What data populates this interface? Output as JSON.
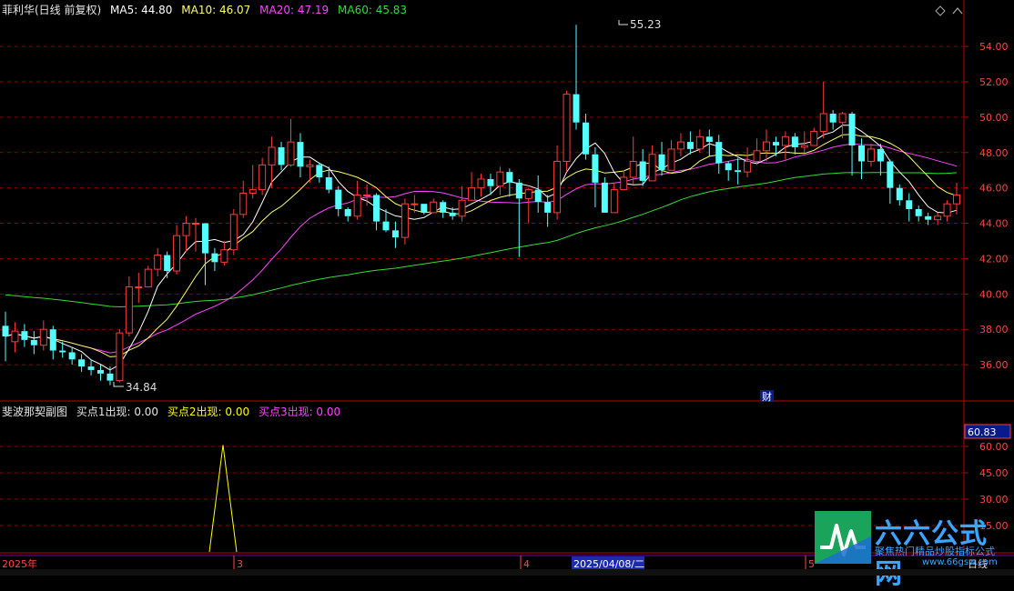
{
  "header": {
    "stock_title": "菲利华(日线 前复权)",
    "ma5": "MA5: 44.80",
    "ma10": "MA10: 46.07",
    "ma20": "MA20: 47.19",
    "ma60": "MA60: 45.83"
  },
  "sub_header": {
    "indicator_name": "斐波那契副图",
    "buy1": "买点1出现: 0.00",
    "buy2": "买点2出现: 0.00",
    "buy3": "买点3出现: 0.00"
  },
  "colors": {
    "up": "#ff3b3b",
    "down": "#54ffff",
    "ma5": "#ffffff",
    "ma10": "#ffff66",
    "ma20": "#ff44ff",
    "ma60": "#33dd33",
    "grid": "#8b0000",
    "axis": "#c00000",
    "label": "#ff4444",
    "indicator": "#ffff00"
  },
  "price_axis": {
    "min": 34,
    "max": 55.6,
    "ticks": [
      "54.00",
      "52.00",
      "50.00",
      "48.00",
      "46.00",
      "44.00",
      "42.00",
      "40.00",
      "38.00",
      "36.00"
    ]
  },
  "indicator_axis": {
    "min": 0,
    "max": 75,
    "ticks": [
      "60.00",
      "45.00",
      "30.00",
      "15.00"
    ],
    "current": "60.83"
  },
  "annotations": {
    "high": "55.23",
    "low": "34.84",
    "finance_marker": "财"
  },
  "bottom_axis": {
    "year": "2025年",
    "month3": "3",
    "month4": "4",
    "month5": "5",
    "date_cursor": "2025/04/08/二",
    "period": "日线"
  },
  "logo": {
    "name": "六六公式网",
    "slogan": "聚焦热门精品炒股指标公式",
    "url": "www.66gsw.com"
  },
  "chart_data": {
    "type": "candlestick",
    "series": [
      {
        "name": "MA5"
      },
      {
        "name": "MA10"
      },
      {
        "name": "MA20"
      },
      {
        "name": "MA60"
      }
    ],
    "candles": [
      [
        38.2,
        37.6,
        39.0,
        36.2
      ],
      [
        37.3,
        37.9,
        38.4,
        36.7
      ],
      [
        37.9,
        37.4,
        38.3,
        37.0
      ],
      [
        37.4,
        37.1,
        37.9,
        36.6
      ],
      [
        37.1,
        38.0,
        38.5,
        36.8
      ],
      [
        38.0,
        36.8,
        38.2,
        36.3
      ],
      [
        36.8,
        36.7,
        37.3,
        36.4
      ],
      [
        36.7,
        36.3,
        37.0,
        36.0
      ],
      [
        36.3,
        35.9,
        36.6,
        35.6
      ],
      [
        35.9,
        35.7,
        36.3,
        35.4
      ],
      [
        35.7,
        35.5,
        36.0,
        35.1
      ],
      [
        35.5,
        35.1,
        35.9,
        34.84
      ],
      [
        35.1,
        37.8,
        38.0,
        35.0
      ],
      [
        37.8,
        40.4,
        41.0,
        37.6
      ],
      [
        40.4,
        40.4,
        41.2,
        39.5
      ],
      [
        40.4,
        41.4,
        41.6,
        40.4
      ],
      [
        41.4,
        42.2,
        42.6,
        41.0
      ],
      [
        42.2,
        41.3,
        42.4,
        40.9
      ],
      [
        41.3,
        43.3,
        43.9,
        41.1
      ],
      [
        43.3,
        44.0,
        44.4,
        42.4
      ],
      [
        44.0,
        44.0,
        44.3,
        42.4
      ],
      [
        44.0,
        42.3,
        44.0,
        40.5
      ],
      [
        42.3,
        41.8,
        42.6,
        41.3
      ],
      [
        41.8,
        42.5,
        43.0,
        41.6
      ],
      [
        42.5,
        44.5,
        44.8,
        42.2
      ],
      [
        44.5,
        45.7,
        46.4,
        44.3
      ],
      [
        45.7,
        45.9,
        47.3,
        45.4
      ],
      [
        45.9,
        47.3,
        47.7,
        45.6
      ],
      [
        47.3,
        48.3,
        48.9,
        46.0
      ],
      [
        48.3,
        47.3,
        48.6,
        47.0
      ],
      [
        47.3,
        48.6,
        49.9,
        47.2
      ],
      [
        48.6,
        47.2,
        49.1,
        46.6
      ],
      [
        47.2,
        47.3,
        47.6,
        46.3
      ],
      [
        47.3,
        46.6,
        47.4,
        46.3
      ],
      [
        46.6,
        45.9,
        47.2,
        45.7
      ],
      [
        45.9,
        44.8,
        46.1,
        44.4
      ],
      [
        44.8,
        44.4,
        44.9,
        44.1
      ],
      [
        44.4,
        45.6,
        46.4,
        44.2
      ],
      [
        45.6,
        45.6,
        46.2,
        45.0
      ],
      [
        45.6,
        44.1,
        45.7,
        43.6
      ],
      [
        44.1,
        43.6,
        44.8,
        43.5
      ],
      [
        43.6,
        43.2,
        44.1,
        42.6
      ],
      [
        43.2,
        45.1,
        45.4,
        42.8
      ],
      [
        45.1,
        45.1,
        45.6,
        44.6
      ],
      [
        45.1,
        44.6,
        45.1,
        44.5
      ],
      [
        44.6,
        45.2,
        45.4,
        44.6
      ],
      [
        45.2,
        44.6,
        45.3,
        44.3
      ],
      [
        44.6,
        44.4,
        44.9,
        44.2
      ],
      [
        44.4,
        45.3,
        46.1,
        44.1
      ],
      [
        45.3,
        46.0,
        46.9,
        45.6
      ],
      [
        46.0,
        46.5,
        46.8,
        45.5
      ],
      [
        46.5,
        46.1,
        46.8,
        45.6
      ],
      [
        46.1,
        46.9,
        47.2,
        45.6
      ],
      [
        46.9,
        46.3,
        47.1,
        45.5
      ],
      [
        46.3,
        45.4,
        46.5,
        42.1
      ],
      [
        45.4,
        45.9,
        46.0,
        44.0
      ],
      [
        45.9,
        45.2,
        46.7,
        44.6
      ],
      [
        45.2,
        44.6,
        45.6,
        43.8
      ],
      [
        44.6,
        47.5,
        48.4,
        44.2
      ],
      [
        47.5,
        51.3,
        51.5,
        46.9
      ],
      [
        51.3,
        49.7,
        55.23,
        49.3
      ],
      [
        49.7,
        47.9,
        50.2,
        47.6
      ],
      [
        47.9,
        46.3,
        48.3,
        44.9
      ],
      [
        46.3,
        44.6,
        46.6,
        44.8
      ],
      [
        44.6,
        45.9,
        46.3,
        45.2
      ],
      [
        45.9,
        46.6,
        47.0,
        46.0
      ],
      [
        46.6,
        47.5,
        48.9,
        46.2
      ],
      [
        47.5,
        46.4,
        48.2,
        46.1
      ],
      [
        46.4,
        47.9,
        48.4,
        46.8
      ],
      [
        47.9,
        47.0,
        48.6,
        46.7
      ],
      [
        47.0,
        48.2,
        48.7,
        47.3
      ],
      [
        48.2,
        48.6,
        49.1,
        47.8
      ],
      [
        48.6,
        48.2,
        49.2,
        47.9
      ],
      [
        48.2,
        48.9,
        49.3,
        48.0
      ],
      [
        48.9,
        48.6,
        49.3,
        47.8
      ],
      [
        48.6,
        47.4,
        49.0,
        46.8
      ],
      [
        47.4,
        47.0,
        47.5,
        46.4
      ],
      [
        47.0,
        46.9,
        47.7,
        46.2
      ],
      [
        46.9,
        47.5,
        48.3,
        46.6
      ],
      [
        47.5,
        48.1,
        48.8,
        47.3
      ],
      [
        48.1,
        48.6,
        49.3,
        47.5
      ],
      [
        48.6,
        48.4,
        48.9,
        47.8
      ],
      [
        48.4,
        48.9,
        49.2,
        47.6
      ],
      [
        48.9,
        48.3,
        49.1,
        47.9
      ],
      [
        48.3,
        48.4,
        49.2,
        48.0
      ],
      [
        48.4,
        49.2,
        49.4,
        48.4
      ],
      [
        49.2,
        50.2,
        52.0,
        48.8
      ],
      [
        50.2,
        49.7,
        50.4,
        49.3
      ],
      [
        49.7,
        50.2,
        50.3,
        48.8
      ],
      [
        50.2,
        48.4,
        50.3,
        46.7
      ],
      [
        48.4,
        47.5,
        48.8,
        46.5
      ],
      [
        47.5,
        48.2,
        48.5,
        47.2
      ],
      [
        48.2,
        47.5,
        48.5,
        46.7
      ],
      [
        47.5,
        46.0,
        47.6,
        45.1
      ],
      [
        46.0,
        45.3,
        46.2,
        45.0
      ],
      [
        45.3,
        44.8,
        45.7,
        44.1
      ],
      [
        44.8,
        44.4,
        45.0,
        44.1
      ],
      [
        44.4,
        44.2,
        44.6,
        43.9
      ],
      [
        44.2,
        44.4,
        44.6,
        43.9
      ],
      [
        44.4,
        45.1,
        45.3,
        44.1
      ],
      [
        45.1,
        45.6,
        46.3,
        44.5
      ]
    ],
    "indicator": [
      0,
      0,
      0,
      0,
      0,
      0,
      0,
      0,
      0,
      0,
      0,
      0,
      0,
      0,
      0,
      0,
      0,
      0,
      0,
      0,
      0,
      0,
      0,
      0,
      0,
      0,
      0,
      0,
      0,
      0,
      0,
      0,
      60.83,
      0,
      0,
      0,
      0,
      0,
      0,
      0
    ]
  }
}
